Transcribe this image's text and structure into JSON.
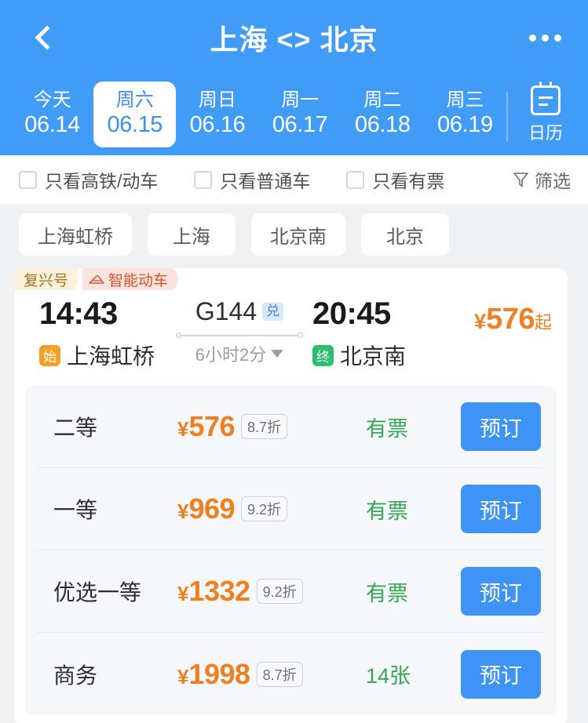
{
  "header": {
    "title": "上海 <> 北京",
    "back_icon": "chevron-left-icon",
    "more_icon": "ellipsis-icon",
    "dates": [
      {
        "dow": "今天",
        "date": "06.14",
        "active": false
      },
      {
        "dow": "周六",
        "date": "06.15",
        "active": true
      },
      {
        "dow": "周日",
        "date": "06.16",
        "active": false
      },
      {
        "dow": "周一",
        "date": "06.17",
        "active": false
      },
      {
        "dow": "周二",
        "date": "06.18",
        "active": false
      },
      {
        "dow": "周三",
        "date": "06.19",
        "active": false
      }
    ],
    "calendar_label": "日历",
    "calendar_icon": "calendar-icon",
    "bg_color": "#419cf7"
  },
  "filters": {
    "checkboxes": [
      {
        "label": "只看高铁/动车",
        "checked": false
      },
      {
        "label": "只看普通车",
        "checked": false
      },
      {
        "label": "只看有票",
        "checked": false
      }
    ],
    "filter_label": "筛选",
    "filter_icon": "funnel-icon"
  },
  "stations": {
    "chips": [
      "上海虹桥",
      "上海",
      "北京南",
      "北京"
    ]
  },
  "train": {
    "tags": [
      {
        "text": "复兴号",
        "icon": null
      },
      {
        "text": "智能动车",
        "icon": "train-icon"
      }
    ],
    "depart_time": "14:43",
    "depart_station": "上海虹桥",
    "depart_badge": "始",
    "train_no": "G144",
    "exchange_badge": "兑",
    "duration": "6小时2分",
    "duration_caret": "caret-down-icon",
    "arrive_time": "20:45",
    "arrive_station": "北京南",
    "arrive_badge": "终",
    "price_currency": "¥",
    "price_from": "576",
    "price_suffix": "起",
    "accent_orange": "#f0801f",
    "accent_blue": "#3d94f6",
    "accent_green": "#34a853"
  },
  "seats": {
    "book_label": "预订",
    "rows": [
      {
        "name": "二等",
        "currency": "¥",
        "price": "576",
        "discount": "8.7折",
        "status": "有票"
      },
      {
        "name": "一等",
        "currency": "¥",
        "price": "969",
        "discount": "9.2折",
        "status": "有票"
      },
      {
        "name": "优选一等",
        "currency": "¥",
        "price": "1332",
        "discount": "9.2折",
        "status": "有票"
      },
      {
        "name": "商务",
        "currency": "¥",
        "price": "1998",
        "discount": "8.7折",
        "status": "14张"
      }
    ]
  }
}
